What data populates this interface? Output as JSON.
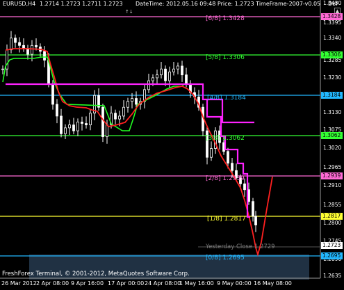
{
  "header": {
    "symbol": "EURUSD,H4",
    "ohlc": "1.2714 1.2723 1.2711 1.2723",
    "indicator_info": "DateTime: 2012.05.16 09:48   Price: 1.2723   TimeFrame-2007-v0.05",
    "def_label": "Def",
    "scroll_up_glyph": "▲",
    "icon_arrows": "↑↓"
  },
  "copyright": "FreshForex Terminal, © 2001-2012, MetaQuotes Software Corp.",
  "x_axis_labels": [
    "26 Mar 2012",
    "2 Apr 08:00",
    "9 Apr 16:00",
    "17 Apr 00:00",
    "24 Apr 08:00",
    "1 May 16:00",
    "9 May 00:00",
    "16 May 08:00"
  ],
  "y_axis_labels": [
    "1.3450",
    "1.3395",
    "1.3340",
    "1.3285",
    "1.3230",
    "1.3175",
    "1.3130",
    "1.3075",
    "1.3020",
    "1.2965",
    "1.2910",
    "1.2855",
    "1.2800",
    "1.2745",
    "1.2690",
    "1.2635"
  ],
  "fib_levels": [
    {
      "label": "[6/8]",
      "value": "1.3428",
      "color": "#ff6ad5"
    },
    {
      "label": "[5/8]",
      "value": "1.3306",
      "color": "#33ff33"
    },
    {
      "label": "[4/8]",
      "value": "1.3184",
      "color": "#22b8ff"
    },
    {
      "label": "[3/8]",
      "value": "1.3062",
      "color": "#33ff33"
    },
    {
      "label": "[2/8]",
      "value": "1.2939",
      "color": "#ff6ad5"
    },
    {
      "label": "[1/8]",
      "value": "1.2817",
      "color": "#ffff33"
    },
    {
      "label": "[0/8]",
      "value": "1.2695",
      "color": "#22b8ff"
    }
  ],
  "current_price": "1.2723",
  "yesterday_close": {
    "label": "Yesterday Close",
    "value": "1.2729"
  },
  "colors": {
    "background": "#000000",
    "candles": "#ffffff",
    "red_line": "#ff2020",
    "magenta_line": "#ff22ff",
    "lime_line": "#22ff22",
    "blue_band": "#3a5a7a"
  }
}
